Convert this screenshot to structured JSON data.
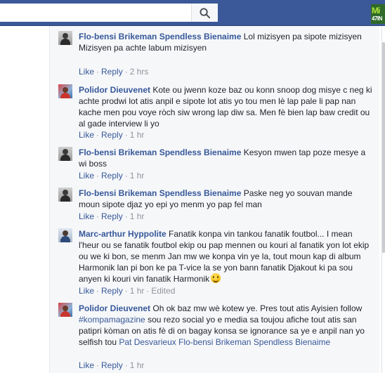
{
  "topbar": {
    "search_placeholder": "",
    "corner_badge_top": "Mi",
    "corner_badge_bottom": "47IN"
  },
  "comments": [
    {
      "author": "Flo-bensi Brikeman Spendless Bienaime",
      "text": "Lol mizisyen pa sipote mizisyen\nMizisyen pa achte labum mizisyen",
      "like": "Like",
      "reply": "Reply",
      "time": "2 hrs"
    },
    {
      "author": "Polidor Dieuvenet",
      "text": "Kote ou jwenn koze baz ou konn snoop dog misye c neg ki achte prodwi lot atis anpil e sipote lot atis yo tou men lè lap pale li pap nan kache men pou voye ròch siw wrong lap diw sa. Men fè bien lap baw credit ou al gade interview li yo",
      "like": "Like",
      "reply": "Reply",
      "time": "1 hr"
    },
    {
      "author": "Flo-bensi Brikeman Spendless Bienaime",
      "text": "Kesyon mwen tap poze mesye a wi boss",
      "like": "Like",
      "reply": "Reply",
      "time": "1 hr"
    },
    {
      "author": "Flo-bensi Brikeman Spendless Bienaime",
      "text": "Paske neg yo souvan mande moun sipote djaz yo epi yo menm yo pap fel man",
      "like": "Like",
      "reply": "Reply",
      "time": "1 hr"
    },
    {
      "author": "Marc-arthur Hyppolite",
      "text": "Fanatik konpa vin tankou fanatik foutbol... I mean l'heur ou se fanatik foutbol ekip ou pap mennen ou kouri al fanatik yon lot ekip ou we ki bon, se menm Jan mw we konpa vin ye la, tout moun kap di album Harmonik lan pi bon ke pa T-vice la se yon bann fanatik Djakout ki pa sou anyen ki kouri vin fanatik Harmonik",
      "like": "Like",
      "reply": "Reply",
      "time": "1 hr",
      "edited": "Edited",
      "emoji": "smiley-face"
    },
    {
      "author": "Polidor Dieuvenet",
      "text_before": "Oh ok baz mw wè kotew ye. Pres tout atis Ayisien follow ",
      "hashtag": "#kompamagazine",
      "text_after": " sou rezo social yo e media sa toujou afiche tout atis san patipri kòman on atis fè di on bagay konsa se ignorance sa ye e anpil nan yo selfish tou ",
      "mentions": "Pat Desvarieux Flo-bensi Brikeman Spendless Bienaime",
      "like": "Like",
      "reply": "Reply",
      "time": "1 hr"
    }
  ],
  "colors": {
    "topbar": "#3b5998",
    "link": "#365899",
    "meta": "#90949c",
    "panel": "#f6f7f9"
  },
  "icons": {
    "search": "search-icon"
  }
}
